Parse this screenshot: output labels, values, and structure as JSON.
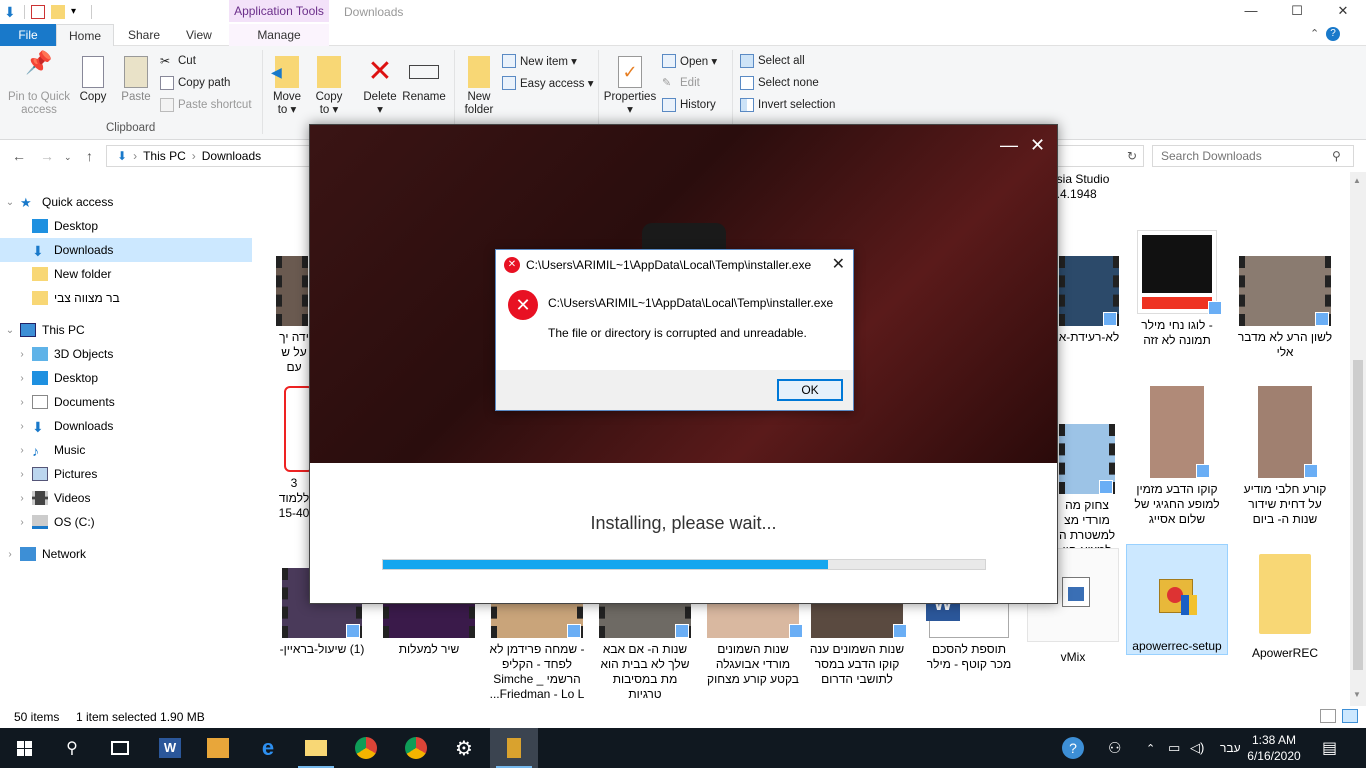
{
  "window": {
    "title": "Downloads",
    "context_tab": "Application Tools",
    "controls": {
      "minimize": "—",
      "maximize": "☐",
      "close": "✕"
    }
  },
  "tabs": [
    "File",
    "Home",
    "Share",
    "View",
    "Manage"
  ],
  "ribbon": {
    "pin": "Pin to Quick access",
    "copy": "Copy",
    "paste": "Paste",
    "cut": "Cut",
    "copy_path": "Copy path",
    "paste_shortcut": "Paste shortcut",
    "clipboard_label": "Clipboard",
    "move_to": "Move to ▾",
    "copy_to": "Copy to ▾",
    "delete": "Delete ▾",
    "rename": "Rename",
    "new_folder": "New folder",
    "new_item": "New item ▾",
    "easy_access": "Easy access ▾",
    "properties": "Properties ▾",
    "open": "Open ▾",
    "edit": "Edit",
    "history": "History",
    "select_all": "Select all",
    "select_none": "Select none",
    "invert_selection": "Invert selection"
  },
  "address": {
    "crumbs": [
      "This PC",
      "Downloads"
    ],
    "search_placeholder": "Search Downloads"
  },
  "nav": [
    {
      "label": "Quick access",
      "level": 0,
      "expanded": true
    },
    {
      "label": "Desktop",
      "level": 1
    },
    {
      "label": "Downloads",
      "level": 1,
      "selected": true
    },
    {
      "label": "New folder",
      "level": 1
    },
    {
      "label": "בר מצווה צבי",
      "level": 1
    },
    {
      "label": "This PC",
      "level": 0,
      "expanded": true
    },
    {
      "label": "3D Objects",
      "level": 1
    },
    {
      "label": "Desktop",
      "level": 1
    },
    {
      "label": "Documents",
      "level": 1
    },
    {
      "label": "Downloads",
      "level": 1
    },
    {
      "label": "Music",
      "level": 1
    },
    {
      "label": "Pictures",
      "level": 1
    },
    {
      "label": "Videos",
      "level": 1
    },
    {
      "label": "OS (C:)",
      "level": 1
    },
    {
      "label": "Network",
      "level": 0
    }
  ],
  "files": {
    "top_partial": [
      "asia Studio",
      "0.4.1948"
    ],
    "row1": [
      {
        "name": "לשון הרע לא מדבר אלי"
      },
      {
        "name": "- לוגו נחי מילר תמונה לא זזה"
      },
      {
        "name": "לא-רעידת-א"
      },
      {
        "name": "ידה יך על ש עם"
      }
    ],
    "row2": [
      {
        "name": "קורע חלבי מודיע על דחית שידור שנות ה- ביום"
      },
      {
        "name": "קוקו הדבע מזמין למופע החגיגי של שלום אסייג"
      },
      {
        "name": "צחוק מה מורדי מצ למשטרת ה למצוא חוו"
      },
      {
        "name": "3 ללמוד 15-40"
      }
    ],
    "row3": [
      {
        "name": "(1) שיעול-בראיין-"
      },
      {
        "name": "שיר למעלות"
      },
      {
        "name": "- שמחה פרידמן לא לפחד - הקליפ הרשמי _ Simche Friedman - Lo L..."
      },
      {
        "name": "שנות ה- אם אבא שלך לא בבית הוא מת במסיבות טרגיות"
      },
      {
        "name": "שנות השמונים מורדי אבועגלה בקטע קורע מצחוק"
      },
      {
        "name": "שנות השמונים ענה קוקו הדבע במסר לתושבי הדרום"
      },
      {
        "name": "תוספת להסכם מכר קוטף - מילר"
      },
      {
        "name": "vMix"
      },
      {
        "name": "apowerrec-setup",
        "selected": true
      },
      {
        "name": "ApowerREC"
      }
    ]
  },
  "installer": {
    "message": "Installing, please wait...",
    "progress": 0.74,
    "controls": {
      "minimize": "—",
      "close": "✕"
    }
  },
  "error_dialog": {
    "title": "C:\\Users\\ARIMIL~1\\AppData\\Local\\Temp\\installer.exe",
    "path": "C:\\Users\\ARIMIL~1\\AppData\\Local\\Temp\\installer.exe",
    "message": "The file or directory is corrupted and unreadable.",
    "ok": "OK",
    "close": "✕"
  },
  "status": {
    "count": "50 items",
    "selection": "1 item selected  1.90 MB"
  },
  "taskbar": {
    "lang": "עבר",
    "time": "1:38 AM",
    "date": "6/16/2020"
  },
  "colors": {
    "accent": "#1979ca",
    "selection": "#cce8ff",
    "progress": "#15a6ef",
    "error": "#e81123",
    "taskbar": "#101820"
  }
}
